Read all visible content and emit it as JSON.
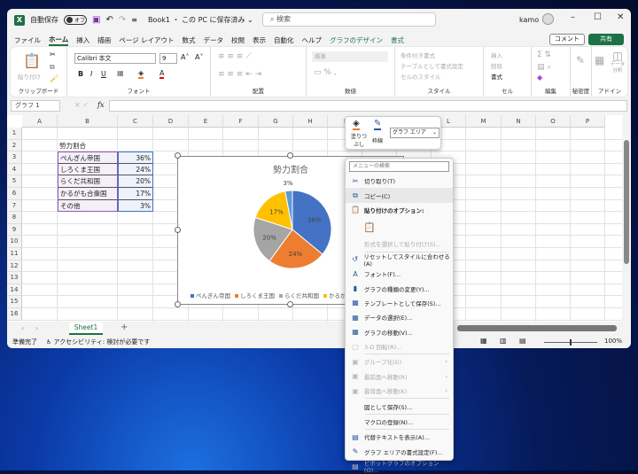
{
  "titlebar": {
    "autosave": "自動保存",
    "toggle": "オフ",
    "doc": "Book1 ・ この PC に保存済み ⌄",
    "search": "検索",
    "user": "kamo"
  },
  "tabs": [
    "ファイル",
    "ホーム",
    "挿入",
    "描画",
    "ページ レイアウト",
    "数式",
    "データ",
    "校閲",
    "表示",
    "自動化",
    "ヘルプ",
    "グラフのデザイン",
    "書式"
  ],
  "comment": "コメント",
  "share": "共有",
  "ribbon": {
    "font_name": "Calibri 本文",
    "font_size": "9",
    "number_format": "標準",
    "groups": [
      "クリップボード",
      "フォント",
      "配置",
      "数値",
      "スタイル",
      "セル",
      "編集",
      "秘密度",
      "アドイン"
    ],
    "paste": "貼り付け",
    "styles": [
      "条件付き書式",
      "テーブルとして書式設定",
      "セルのスタイル"
    ],
    "cells": [
      "挿入",
      "削除",
      "書式"
    ],
    "sens": "秘密度",
    "addin": "アドイン",
    "analyze": "データ分析"
  },
  "namebox": "グラフ 1",
  "fx": "fx",
  "columns": [
    "A",
    "B",
    "C",
    "D",
    "E",
    "F",
    "G",
    "H",
    "I",
    "J",
    "K",
    "L",
    "M",
    "N",
    "O",
    "P"
  ],
  "rows": [
    "1",
    "2",
    "3",
    "4",
    "5",
    "6",
    "7",
    "8",
    "9",
    "10",
    "11",
    "12",
    "13",
    "14",
    "15",
    "16"
  ],
  "sheet": {
    "title": "勢力割合",
    "items": [
      {
        "name": "ぺんぎん帝国",
        "value": "36%"
      },
      {
        "name": "しろくま王国",
        "value": "24%"
      },
      {
        "name": "らくだ共和国",
        "value": "20%"
      },
      {
        "name": "かるがも合衆国",
        "value": "17%"
      },
      {
        "name": "その他",
        "value": "3%"
      }
    ]
  },
  "chart_data": {
    "type": "pie",
    "title": "勢力割合",
    "categories": [
      "ぺんぎん帝国",
      "しろくま王国",
      "らくだ共和国",
      "かるがも合衆国",
      "その他"
    ],
    "values": [
      36,
      24,
      20,
      17,
      3
    ],
    "labels": [
      "36%",
      "24%",
      "20%",
      "17%",
      "3%"
    ],
    "colors": [
      "#4472c4",
      "#ed7d31",
      "#a5a5a5",
      "#ffc000",
      "#5b9bd5"
    ],
    "legend": "bottom"
  },
  "minibar": {
    "fill": "塗りつぶし",
    "outline": "枠線",
    "element": "グラフ エリア"
  },
  "context_menu": {
    "search": "メニューの検索",
    "items": [
      {
        "label": "切り取り(T)",
        "icon": "scissors-icon",
        "ic": "✂"
      },
      {
        "label": "コピー(C)",
        "icon": "copy-icon",
        "ic": "⧉",
        "hl": true
      },
      {
        "label": "貼り付けのオプション:",
        "icon": "paste-icon",
        "ic": "📋",
        "bold": true,
        "dis_icon": true
      },
      {
        "label": "",
        "icon": "paste-option-icon",
        "ic": "📋",
        "dis": true
      },
      {
        "label": "形式を選択して貼り付け(S)...",
        "dis": true,
        "icon": "none"
      },
      {
        "sep": true
      },
      {
        "label": "リセットしてスタイルに合わせる(A)",
        "icon": "reset-style-icon",
        "ic": "↺"
      },
      {
        "label": "フォント(F)...",
        "icon": "font-icon",
        "ic": "A"
      },
      {
        "label": "グラフの種類の変更(Y)...",
        "icon": "chart-type-icon",
        "ic": "▮"
      },
      {
        "label": "テンプレートとして保存(S)...",
        "icon": "template-icon",
        "ic": "▦"
      },
      {
        "label": "データの選択(E)...",
        "icon": "select-data-icon",
        "ic": "▦"
      },
      {
        "label": "グラフの移動(V)...",
        "icon": "move-chart-icon",
        "ic": "▦"
      },
      {
        "label": "3-D 回転(R)...",
        "icon": "rotate-icon",
        "ic": "▢",
        "dis": true
      },
      {
        "sep": true
      },
      {
        "label": "グループ化(G)",
        "icon": "group-icon",
        "ic": "▣",
        "dis": true,
        "sub": "›"
      },
      {
        "label": "最前面へ移動(R)",
        "icon": "bring-front-icon",
        "ic": "▣",
        "dis": true,
        "sub": "›"
      },
      {
        "label": "最背面へ移動(K)",
        "icon": "send-back-icon",
        "ic": "▣",
        "dis": true,
        "sub": "›"
      },
      {
        "sep": true
      },
      {
        "label": "図として保存(S)...",
        "icon": "none"
      },
      {
        "sep": true
      },
      {
        "label": "マクロの登録(N)...",
        "icon": "none"
      },
      {
        "sep": true
      },
      {
        "label": "代替テキストを表示(A)...",
        "icon": "alt-text-icon",
        "ic": "▤"
      },
      {
        "label": "グラフ エリアの書式設定(F)...",
        "icon": "format-icon",
        "ic": "✎"
      },
      {
        "label": "ピボットグラフのオプション(O)...",
        "icon": "pivot-icon",
        "ic": "▤",
        "dis": true
      }
    ]
  },
  "sheet_tab": "Sheet1",
  "add_sheet": "+",
  "status": {
    "ready": "準備完了",
    "access": "アクセシビリティ: 検討が必要です",
    "zoom": "100%",
    "zoom_value": 100
  }
}
